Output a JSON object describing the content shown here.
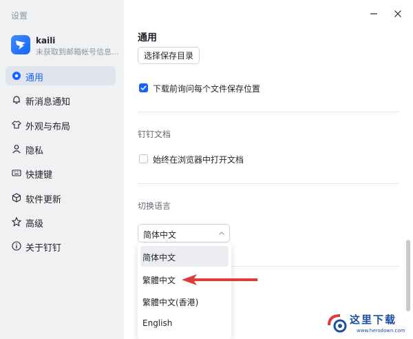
{
  "window": {
    "title": "设置"
  },
  "profile": {
    "name": "kaili",
    "subtitle": "未获取到邮箱帐号信息..."
  },
  "sidebar": {
    "items": [
      {
        "label": "通用",
        "icon": "settings-icon",
        "active": true
      },
      {
        "label": "新消息通知",
        "icon": "bell-icon"
      },
      {
        "label": "外观与布局",
        "icon": "shirt-icon"
      },
      {
        "label": "隐私",
        "icon": "person-icon"
      },
      {
        "label": "快捷键",
        "icon": "keyboard-icon"
      },
      {
        "label": "软件更新",
        "icon": "box-icon"
      },
      {
        "label": "高级",
        "icon": "star-icon"
      },
      {
        "label": "关于钉钉",
        "icon": "info-icon"
      }
    ]
  },
  "main": {
    "section_title": "通用",
    "choose_dir_button": "选择保存目录",
    "ask_save_location": {
      "label": "下载前询问每个文件保存位置",
      "checked": true
    },
    "dingtalk_docs": {
      "title": "钉钉文档",
      "open_in_browser": {
        "label": "始终在浏览器中打开文档",
        "checked": false
      }
    },
    "language": {
      "title": "切换语言",
      "selected": "简体中文",
      "options": [
        "简体中文",
        "繁體中文",
        "繁體中文(香港)",
        "English"
      ]
    }
  },
  "watermark": {
    "text": "这里下载",
    "url": "www.herodown.com"
  },
  "colors": {
    "accent": "#1664ff",
    "sidebar_bg": "#f0f1f3",
    "annotation_arrow": "#e03b3b"
  }
}
